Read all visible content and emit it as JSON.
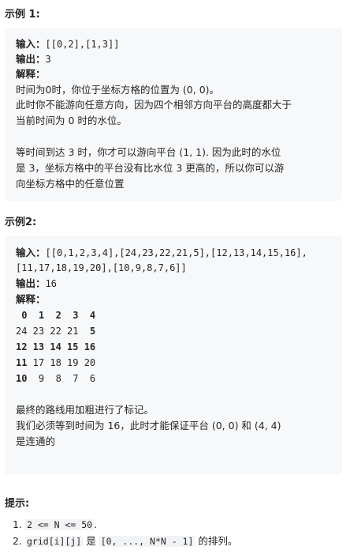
{
  "example1": {
    "heading": "示例 1:",
    "input_label": "输入：",
    "input_value": "[[0,2],[1,3]]",
    "output_label": "输出：",
    "output_value": "3",
    "explain_label": "解释：",
    "p1_line1": "时间为0时，你位于坐标方格的位置为 (0, 0)。",
    "p1_line2": "此时你不能游向任意方向，因为四个相邻方向平台的高度都大于",
    "p1_line3": "当前时间为 0 时的水位。",
    "p2_line1": "等时间到达 3 时，你才可以游向平台 (1, 1). 因为此时的水位",
    "p2_line2": "是 3，坐标方格中的平台没有比水位 3 更高的，所以你可以游",
    "p2_line3": "向坐标方格中的任意位置"
  },
  "example2": {
    "heading": "示例2:",
    "input_label": "输入：",
    "input_line1": "[[0,1,2,3,4],[24,23,22,21,5],[12,13,14,15,16],",
    "input_line2": "[11,17,18,19,20],[10,9,8,7,6]]",
    "output_label": "输出：",
    "output_value": "16",
    "explain_label": "解释：",
    "grid": [
      " 0  1  2  3  4",
      "24 23 22 21  5",
      "12 13 14 15 16",
      "11 17 18 19 20",
      "10  9  8  7  6"
    ],
    "note1": "最终的路线用加粗进行了标记。",
    "note2": "我们必须等到时间为 16，此时才能保证平台 (0, 0) 和 (4, 4)",
    "note3": "是连通的"
  },
  "hints": {
    "heading": "提示:",
    "item1_num": "1.",
    "item1_code": "2 <= N <= 50",
    "item1_tail": ".",
    "item2_num": "2.",
    "item2_code1": "grid[i][j]",
    "item2_mid": " 是 ",
    "item2_code2": "[0, ..., N*N - 1]",
    "item2_tail": " 的排列。"
  }
}
